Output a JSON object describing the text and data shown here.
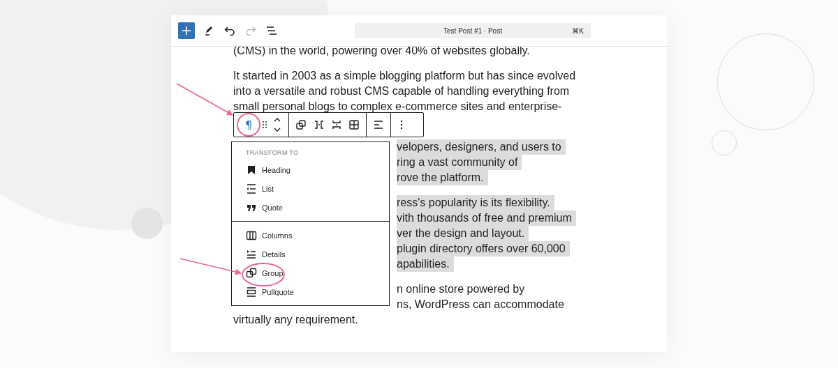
{
  "header": {
    "tools": [
      {
        "kind": "add",
        "disabled": false
      },
      {
        "kind": "edit",
        "disabled": false
      },
      {
        "kind": "undo",
        "disabled": false
      },
      {
        "kind": "redo",
        "disabled": true
      },
      {
        "kind": "outline",
        "disabled": false
      }
    ],
    "command_bar": {
      "title": "Test Post #1 · Post",
      "shortcut": "⌘K"
    }
  },
  "content": {
    "paragraphs": [
      {
        "selected": false,
        "lines": [
          {
            "kind": "full",
            "text": "(CMS) in the world, powering over 40% of websites globally."
          }
        ]
      },
      {
        "selected": false,
        "lines": [
          {
            "kind": "full",
            "text": "It started in 2003 as a simple blogging platform but has since evolved"
          },
          {
            "kind": "full",
            "text": "into a versatile and robust CMS capable of handling everything from"
          },
          {
            "kind": "full",
            "text": "small personal blogs to complex e-commerce sites and enterprise-"
          }
        ]
      },
      {
        "selected": true,
        "lines": [
          {
            "kind": "covered",
            "right": "velopers, designers, and users to"
          },
          {
            "kind": "covered",
            "right": "ring a vast community of"
          },
          {
            "kind": "covered",
            "right": "rove the platform."
          }
        ]
      },
      {
        "selected": true,
        "lines": [
          {
            "kind": "covered",
            "right": "ress's popularity is its flexibility."
          },
          {
            "kind": "covered",
            "right": "vith thousands of free and premium"
          },
          {
            "kind": "covered",
            "right": "ver the design and layout."
          },
          {
            "kind": "covered",
            "right": "plugin directory offers over 60,000"
          },
          {
            "kind": "covered",
            "right": "apabilities."
          }
        ]
      },
      {
        "selected": false,
        "lines": [
          {
            "kind": "covered",
            "right": "n online store powered by"
          },
          {
            "kind": "covered",
            "right": "ns, WordPress can accommodate"
          },
          {
            "kind": "full",
            "text": "virtually any requirement."
          }
        ]
      }
    ]
  },
  "block_toolbar": {
    "groups": [
      [
        {
          "kind": "paragraph",
          "label": "¶",
          "selected": true,
          "annotated": true
        },
        {
          "kind": "drag",
          "selected": false,
          "annotated": false
        },
        {
          "kind": "move",
          "selected": false,
          "annotated": false
        }
      ],
      [
        {
          "kind": "group",
          "selected": false,
          "annotated": false
        },
        {
          "kind": "row",
          "selected": false,
          "annotated": false
        },
        {
          "kind": "stack",
          "selected": false,
          "annotated": false
        },
        {
          "kind": "grid",
          "selected": false,
          "annotated": false
        }
      ],
      [
        {
          "kind": "align",
          "selected": false,
          "annotated": false
        }
      ],
      [
        {
          "kind": "more",
          "selected": false,
          "annotated": false
        }
      ]
    ]
  },
  "transform_menu": {
    "heading": "TRANSFORM TO",
    "sections": [
      [
        {
          "label": "Heading",
          "kind": "heading",
          "annotated": false
        },
        {
          "label": "List",
          "kind": "list",
          "annotated": false
        },
        {
          "label": "Quote",
          "kind": "quote",
          "annotated": false
        }
      ],
      [
        {
          "label": "Columns",
          "kind": "columns",
          "annotated": false
        },
        {
          "label": "Details",
          "kind": "details",
          "annotated": false
        },
        {
          "label": "Group",
          "kind": "group",
          "annotated": true
        },
        {
          "label": "Pullquote",
          "kind": "pullquote",
          "annotated": false
        }
      ]
    ]
  }
}
